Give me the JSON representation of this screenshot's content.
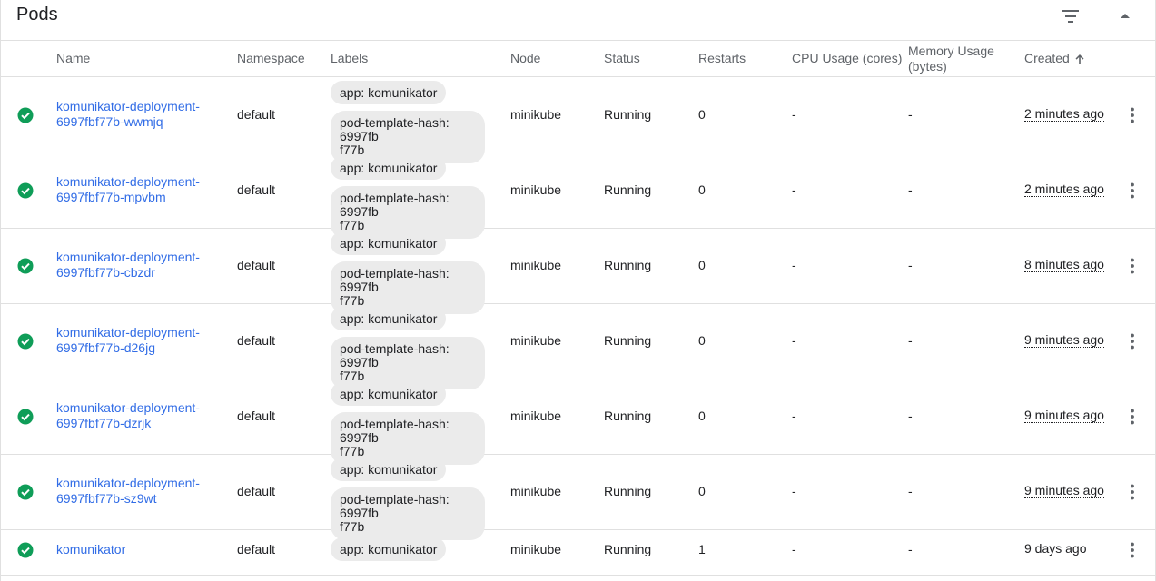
{
  "header": {
    "title": "Pods"
  },
  "columns": {
    "name": "Name",
    "namespace": "Namespace",
    "labels": "Labels",
    "node": "Node",
    "status": "Status",
    "restarts": "Restarts",
    "cpu": "CPU Usage (cores)",
    "memory_line1": "Memory Usage",
    "memory_line2": "(bytes)",
    "created": "Created"
  },
  "colors": {
    "link": "#326de6",
    "success": "#0f9d58",
    "chip": "#ebebeb"
  },
  "icons": {
    "status": "check-circle-icon",
    "filter": "filter-icon",
    "collapse": "collapse-arrow-icon",
    "menu": "more-vert-icon",
    "sort": "arrow-up-icon"
  },
  "rows": [
    {
      "name_line1": "komunikator-deployment-",
      "name_line2": "6997fbf77b-wwmjq",
      "namespace": "default",
      "label1": "app: komunikator",
      "label2_line1": "pod-template-hash: 6997fb",
      "label2_line2": "f77b",
      "node": "minikube",
      "status": "Running",
      "restarts": "0",
      "cpu": "-",
      "memory": "-",
      "created": "2 minutes ago"
    },
    {
      "name_line1": "komunikator-deployment-",
      "name_line2": "6997fbf77b-mpvbm",
      "namespace": "default",
      "label1": "app: komunikator",
      "label2_line1": "pod-template-hash: 6997fb",
      "label2_line2": "f77b",
      "node": "minikube",
      "status": "Running",
      "restarts": "0",
      "cpu": "-",
      "memory": "-",
      "created": "2 minutes ago"
    },
    {
      "name_line1": "komunikator-deployment-",
      "name_line2": "6997fbf77b-cbzdr",
      "namespace": "default",
      "label1": "app: komunikator",
      "label2_line1": "pod-template-hash: 6997fb",
      "label2_line2": "f77b",
      "node": "minikube",
      "status": "Running",
      "restarts": "0",
      "cpu": "-",
      "memory": "-",
      "created": "8 minutes ago"
    },
    {
      "name_line1": "komunikator-deployment-",
      "name_line2": "6997fbf77b-d26jg",
      "namespace": "default",
      "label1": "app: komunikator",
      "label2_line1": "pod-template-hash: 6997fb",
      "label2_line2": "f77b",
      "node": "minikube",
      "status": "Running",
      "restarts": "0",
      "cpu": "-",
      "memory": "-",
      "created": "9 minutes ago"
    },
    {
      "name_line1": "komunikator-deployment-",
      "name_line2": "6997fbf77b-dzrjk",
      "namespace": "default",
      "label1": "app: komunikator",
      "label2_line1": "pod-template-hash: 6997fb",
      "label2_line2": "f77b",
      "node": "minikube",
      "status": "Running",
      "restarts": "0",
      "cpu": "-",
      "memory": "-",
      "created": "9 minutes ago"
    },
    {
      "name_line1": "komunikator-deployment-",
      "name_line2": "6997fbf77b-sz9wt",
      "namespace": "default",
      "label1": "app: komunikator",
      "label2_line1": "pod-template-hash: 6997fb",
      "label2_line2": "f77b",
      "node": "minikube",
      "status": "Running",
      "restarts": "0",
      "cpu": "-",
      "memory": "-",
      "created": "9 minutes ago"
    },
    {
      "name_line1": "komunikator",
      "name_line2": "",
      "namespace": "default",
      "label1": "app: komunikator",
      "label2_line1": "",
      "label2_line2": "",
      "node": "minikube",
      "status": "Running",
      "restarts": "1",
      "cpu": "-",
      "memory": "-",
      "created": "9 days ago"
    }
  ]
}
